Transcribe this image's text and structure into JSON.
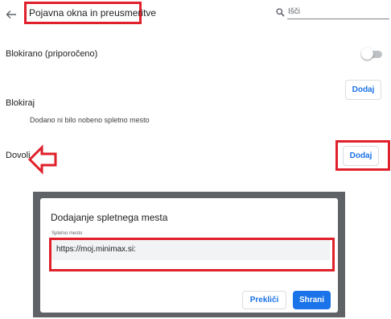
{
  "header": {
    "title": "Pojavna okna in preusmeritve",
    "search_placeholder": "Išči"
  },
  "settings": {
    "blocked_default_label": "Blokirano (priporočeno)",
    "blocked_default_enabled": false,
    "block_section_label": "Blokiraj",
    "block_add_label": "Dodaj",
    "block_empty_text": "Dodano ni bilo nobeno spletno mesto",
    "allow_section_label": "Dovoli",
    "allow_add_label": "Dodaj"
  },
  "dialog": {
    "title": "Dodajanje spletnega mesta",
    "field_label": "Spletno mesto",
    "field_value": "https://moj.minimax.si:",
    "cancel_label": "Prekliči",
    "save_label": "Shrani"
  },
  "colors": {
    "accent": "#1a73e8",
    "highlight": "#e0202a"
  }
}
